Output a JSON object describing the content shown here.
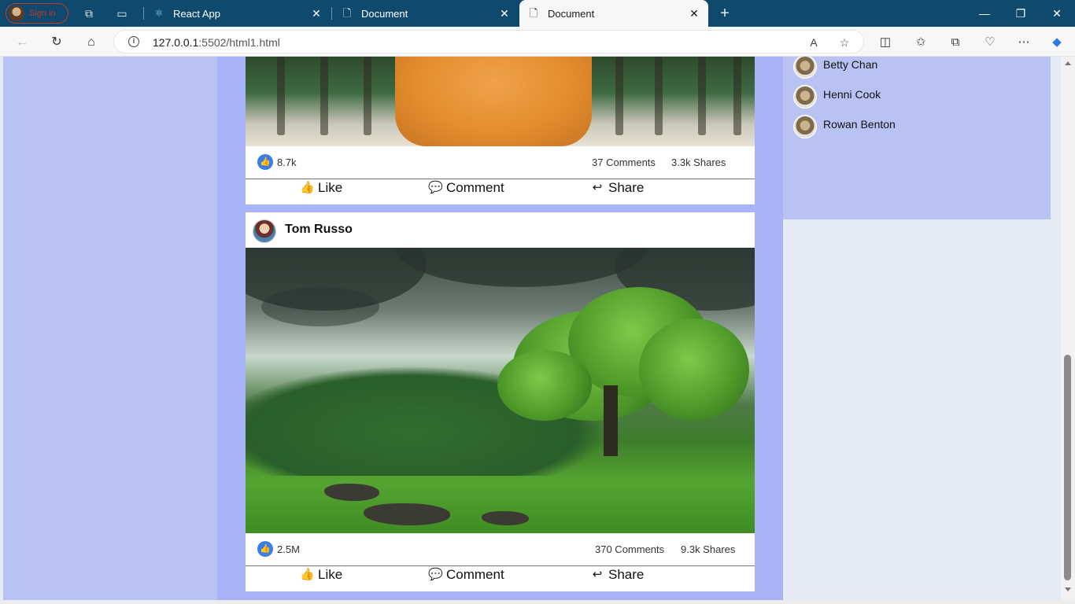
{
  "browser": {
    "profile_label": "Sign in",
    "tabs": [
      {
        "title": "React App",
        "icon": "react-icon"
      },
      {
        "title": "Document",
        "icon": "document-icon"
      },
      {
        "title": "Document",
        "icon": "document-icon",
        "active": true
      }
    ],
    "url_host": "127.0.0.1",
    "url_path": ":5502/html1.html"
  },
  "posts": [
    {
      "likes": "8.7k",
      "comments": "37 Comments",
      "shares": "3.3k Shares",
      "actions": {
        "like": "Like",
        "comment": "Comment",
        "share": "Share"
      }
    },
    {
      "author": "Tom Russo",
      "likes": "2.5M",
      "comments": "370 Comments",
      "shares": "9.3k Shares",
      "actions": {
        "like": "Like",
        "comment": "Comment",
        "share": "Share"
      }
    }
  ],
  "contacts": [
    {
      "name": "Betty Chan"
    },
    {
      "name": "Henni Cook"
    },
    {
      "name": "Rowan Benton"
    }
  ],
  "colors": {
    "tabbar": "#0f4a6e",
    "center_bg": "#a8b4f7",
    "sidebar_bg": "#b8c3f3",
    "page_bg": "#e4ebf5",
    "like_blue": "#3b7de6"
  }
}
